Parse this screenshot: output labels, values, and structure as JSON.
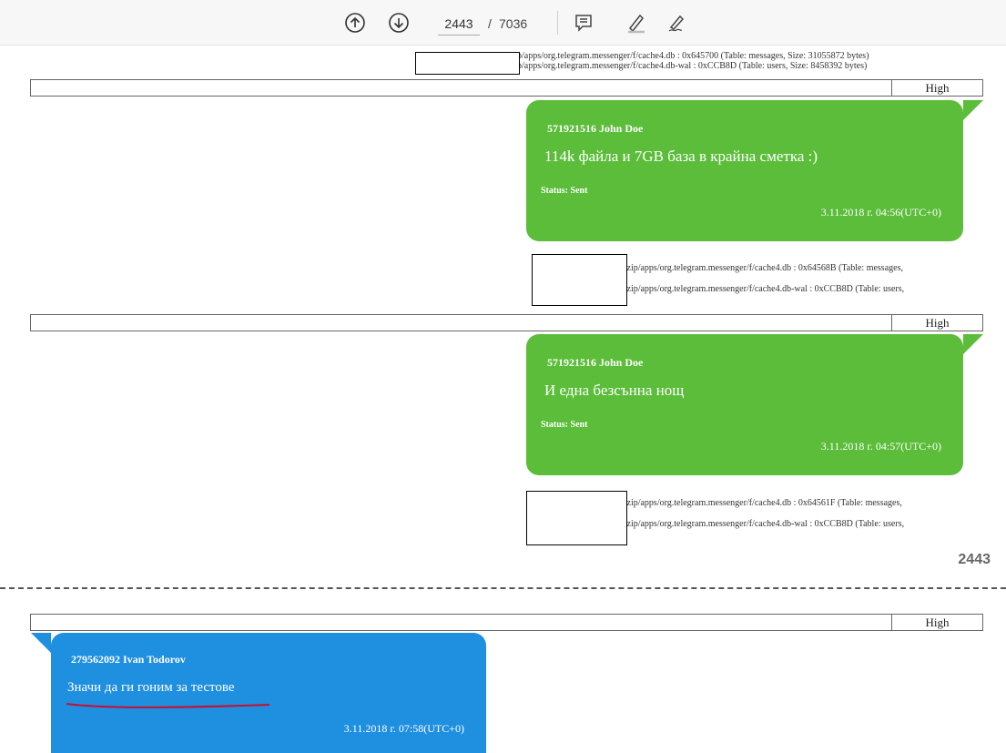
{
  "toolbar": {
    "current_page": "2443",
    "separator": "/",
    "total_pages": "7036",
    "icons": [
      "arrow-up-circle-icon",
      "arrow-down-circle-icon",
      "comment-icon",
      "highlight-pen-icon",
      "sign-icon"
    ]
  },
  "top_sources": {
    "line1": "p/apps/org.telegram.messenger/f/cache4.db : 0x645700 (Table: messages, Size: 31055872 bytes)",
    "line2": "p/apps/org.telegram.messenger/f/cache4.db-wal : 0xCCB8D (Table: users, Size: 8458392 bytes)"
  },
  "records": [
    {
      "priority": "High",
      "sender": "571921516 John Doe",
      "message": "114k файла и 7GB база в крайна сметка :)",
      "status_label": "Status:",
      "status_value": "Sent",
      "time": "3.11.2018 г. 04:56(UTC+0)",
      "source1": ".zip/apps/org.telegram.messenger/f/cache4.db : 0x64568B (Table: messages,",
      "source2": ".zip/apps/org.telegram.messenger/f/cache4.db-wal : 0xCCB8D (Table: users,"
    },
    {
      "priority": "High",
      "sender": "571921516 John Doe",
      "message": "И една безсънна нощ",
      "status_label": "Status:",
      "status_value": "Sent",
      "time": "3.11.2018 г. 04:57(UTC+0)",
      "source1": ".zip/apps/org.telegram.messenger/f/cache4.db : 0x64561F (Table: messages,",
      "source2": ".zip/apps/org.telegram.messenger/f/cache4.db-wal : 0xCCB8D (Table: users,"
    },
    {
      "priority": "High",
      "sender": "279562092 Ivan Todorov",
      "message": "Значи да ги гоним за тестове",
      "time": "3.11.2018 г. 07:58(UTC+0)"
    }
  ],
  "page_footer_number": "2443",
  "colors": {
    "outgoing_bubble": "#5bbd3a",
    "incoming_bubble": "#1f8fe0",
    "underline_annotation": "#c8102e"
  }
}
